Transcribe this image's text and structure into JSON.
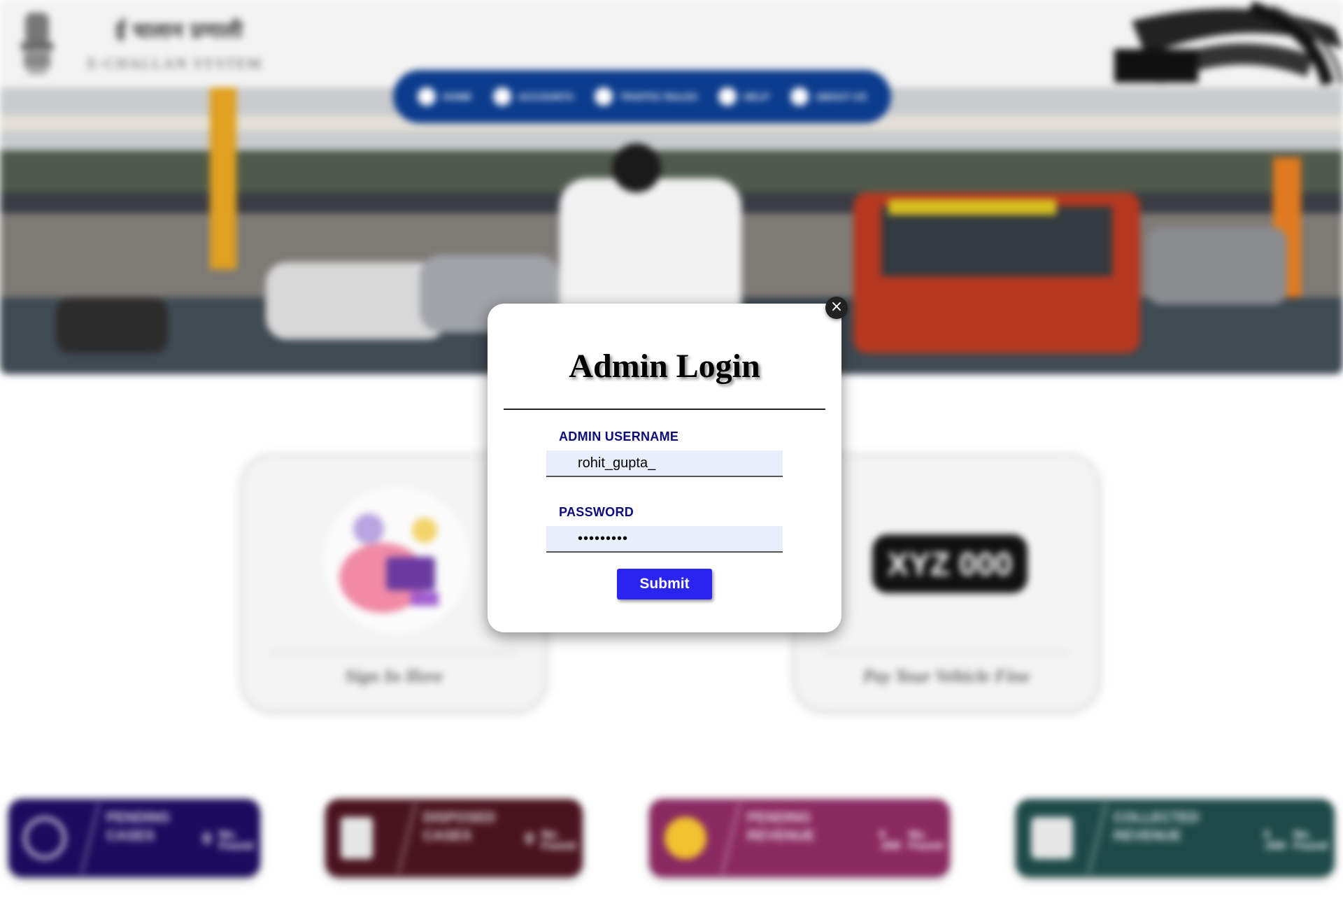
{
  "header": {
    "hindi_title": "ई चालान प्रणाली",
    "english_title": "E-CHALLAN SYSTEM"
  },
  "nav": {
    "items": [
      {
        "label": "HOME",
        "icon": "home-icon"
      },
      {
        "label": "ACCOUNTS",
        "icon": "user-icon"
      },
      {
        "label": "TRAFFIC RULES",
        "icon": "rules-icon"
      },
      {
        "label": "HELP",
        "icon": "help-icon"
      },
      {
        "label": "ABOUT US",
        "icon": "info-icon"
      }
    ]
  },
  "cards": {
    "signin": {
      "caption": "Sign In Here"
    },
    "pay": {
      "caption": "Pay Your Vehicle Fine",
      "plate": "XYZ 000"
    }
  },
  "stats": [
    {
      "title": "PENDING\nCASES",
      "value": "0",
      "unit": "No.\nFound",
      "color": "#1b0b5e"
    },
    {
      "title": "DISPOSED\nCASES",
      "value": "0",
      "unit": "No.\nFound",
      "color": "#4a1320"
    },
    {
      "title": "PENDING\nREVENUE",
      "value": "0\n.000",
      "unit": "No.\nFound",
      "color": "#8a2960"
    },
    {
      "title": "COLLECTED\nREVENUE",
      "value": "0\n.000",
      "unit": "No.\nFound",
      "color": "#1d4a48"
    }
  ],
  "modal": {
    "title": "Admin Login",
    "close_label": "×",
    "username_label": "ADMIN USERNAME",
    "username_value": "rohit_gupta_",
    "password_label": "PASSWORD",
    "password_value": "•••••••••",
    "submit_label": "Submit"
  },
  "colors": {
    "nav_blue": "#0b3b8c",
    "label_navy": "#0b0b7a",
    "submit_blue": "#2a24f0",
    "field_bg": "#e8effb"
  }
}
